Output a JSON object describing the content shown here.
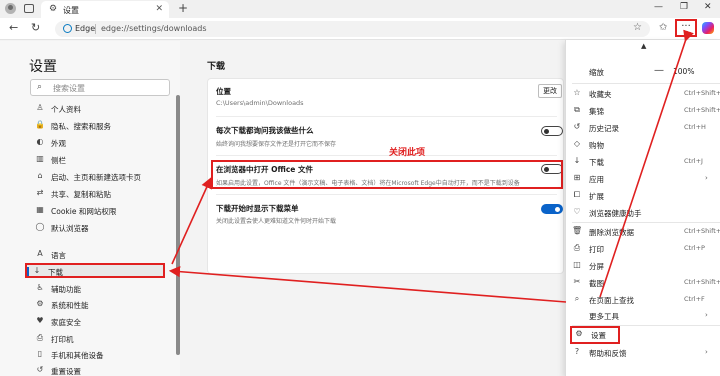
{
  "browser": {
    "tab_title": "设置",
    "address_label": "Edge",
    "url": "edge://settings/downloads",
    "more_button_label": "···"
  },
  "sidebar": {
    "title": "设置",
    "search_placeholder": "搜索设置",
    "items": [
      {
        "icon": "person-icon",
        "glyph": "♙",
        "label": "个人资料"
      },
      {
        "icon": "lock-icon",
        "glyph": "🔒",
        "label": "隐私、搜索和服务"
      },
      {
        "icon": "appearance-icon",
        "glyph": "◐",
        "label": "外观"
      },
      {
        "icon": "sidebar-icon",
        "glyph": "▥",
        "label": "侧栏"
      },
      {
        "icon": "home-icon",
        "glyph": "⌂",
        "label": "启动、主页和新建选项卡页"
      },
      {
        "icon": "share-icon",
        "glyph": "⇄",
        "label": "共享、复制和粘贴"
      },
      {
        "icon": "cookie-icon",
        "glyph": "▦",
        "label": "Cookie 和网站权限"
      },
      {
        "icon": "browser-icon",
        "glyph": "◯",
        "label": "默认浏览器"
      },
      {
        "icon": "language-icon",
        "glyph": "A",
        "label": "语言"
      },
      {
        "icon": "download-icon",
        "glyph": "↓",
        "label": "下载"
      },
      {
        "icon": "accessibility-icon",
        "glyph": "♿",
        "label": "辅助功能"
      },
      {
        "icon": "system-icon",
        "glyph": "⚙",
        "label": "系统和性能"
      },
      {
        "icon": "family-icon",
        "glyph": "♥",
        "label": "家庭安全"
      },
      {
        "icon": "printer-icon",
        "glyph": "⎙",
        "label": "打印机"
      },
      {
        "icon": "phone-icon",
        "glyph": "▯",
        "label": "手机和其他设备"
      },
      {
        "icon": "reset-icon",
        "glyph": "↺",
        "label": "重置设置"
      }
    ]
  },
  "main": {
    "title": "下载",
    "location_label": "位置",
    "location_value": "C:\\Users\\admin\\Downloads",
    "change_button": "更改",
    "ask_label": "每次下载都询问我该做些什么",
    "ask_sub": "始终询问我想要保存文件还是打开它而不保存",
    "ask_state": "off",
    "office_label": "在浏览器中打开 Office 文件",
    "office_sub": "如果启用此设置，Office 文件（演示文稿、电子表格、文档）将在Microsoft Edge中自动打开，而不是下载到设备",
    "office_state": "off",
    "show_menu_label": "下载开始时显示下载菜单",
    "show_menu_sub": "关闭此设置会使人更难知道文件何时开始下载",
    "show_menu_state": "on"
  },
  "annotation": {
    "text": "关闭此项",
    "color": "#e02020"
  },
  "menu": {
    "zoom_label": "缩放",
    "zoom_minus": "—",
    "zoom_value": "100%",
    "items": [
      {
        "icon": "star-icon",
        "glyph": "☆",
        "label": "收藏夹",
        "shortcut": "Ctrl+Shift+O"
      },
      {
        "icon": "collections-icon",
        "glyph": "⧉",
        "label": "集锦",
        "shortcut": "Ctrl+Shift+Y"
      },
      {
        "icon": "history-icon",
        "glyph": "↺",
        "label": "历史记录",
        "shortcut": "Ctrl+H"
      },
      {
        "icon": "shopping-icon",
        "glyph": "◇",
        "label": "购物",
        "shortcut": ""
      },
      {
        "icon": "download-icon",
        "glyph": "↓",
        "label": "下载",
        "shortcut": "Ctrl+J"
      },
      {
        "icon": "apps-icon",
        "glyph": "⊞",
        "label": "应用",
        "shortcut": "",
        "arrow": "›"
      },
      {
        "icon": "extensions-icon",
        "glyph": "⧠",
        "label": "扩展",
        "shortcut": ""
      },
      {
        "icon": "health-icon",
        "glyph": "♡",
        "label": "浏览器健康助手",
        "shortcut": ""
      },
      {
        "icon": "delete-icon",
        "glyph": "🗑",
        "label": "删除浏览数据",
        "shortcut": "Ctrl+Shift+Delete"
      },
      {
        "icon": "print-icon",
        "glyph": "⎙",
        "label": "打印",
        "shortcut": "Ctrl+P"
      },
      {
        "icon": "split-screen-icon",
        "glyph": "◫",
        "label": "分屏",
        "shortcut": ""
      },
      {
        "icon": "screenshot-icon",
        "glyph": "✂",
        "label": "截图",
        "shortcut": "Ctrl+Shift+S"
      },
      {
        "icon": "find-icon",
        "glyph": "⌕",
        "label": "在页面上查找",
        "shortcut": "Ctrl+F"
      },
      {
        "icon": "more-tools-icon",
        "glyph": "",
        "label": "更多工具",
        "shortcut": "",
        "arrow": "›"
      },
      {
        "icon": "gear-icon",
        "glyph": "⚙",
        "label": "设置",
        "shortcut": ""
      },
      {
        "icon": "help-icon",
        "glyph": "?",
        "label": "帮助和反馈",
        "shortcut": "",
        "arrow": "›"
      }
    ]
  }
}
